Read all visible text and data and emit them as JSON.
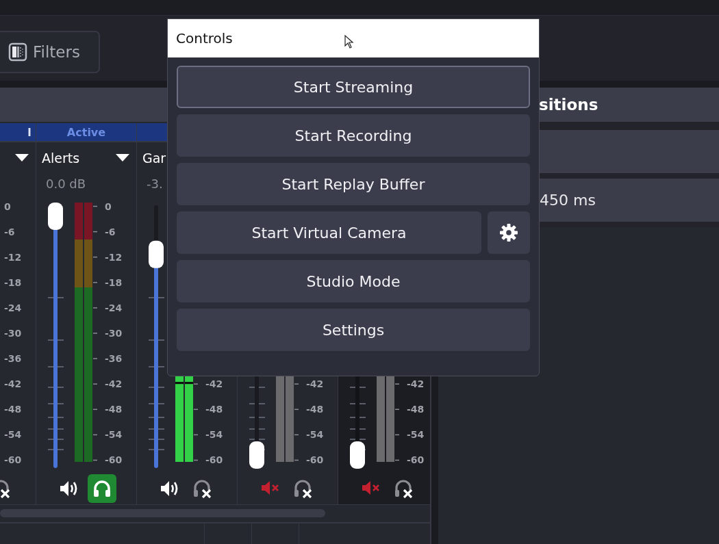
{
  "mixer_toolbar": {
    "filters_button": "Filters"
  },
  "mixer": {
    "channels": [
      {
        "tag": "l",
        "selected": false,
        "monitoring": false,
        "scale": [
          "0",
          "-6",
          "-12",
          "-18",
          "-24",
          "-30",
          "-36",
          "-42",
          "-48",
          "-54",
          "-60"
        ]
      },
      {
        "tag": "Active",
        "name": "Alerts",
        "readout": "0.0 dB",
        "fader": {
          "level": 1.0
        },
        "muted": false,
        "monitoring": true,
        "selected": false,
        "scale": [
          "0",
          "-6",
          "-12",
          "-18",
          "-24",
          "-30",
          "-36",
          "-42",
          "-48",
          "-54",
          "-60"
        ]
      },
      {
        "name": "Gar",
        "readout": "-3.",
        "fader": {
          "level": 0.84
        },
        "meter": {
          "level": 0.34
        },
        "muted": false,
        "monitoring": false,
        "selected": false,
        "scale": [
          "-42",
          "-48",
          "-54",
          "-60"
        ]
      },
      {
        "fader": {
          "level": 0
        },
        "muted": true,
        "monitoring": false,
        "selected": false,
        "scale": [
          "-42",
          "-48",
          "-54",
          "-60"
        ]
      },
      {
        "fader": {
          "level": 0
        },
        "muted": true,
        "monitoring": false,
        "selected": true,
        "scale": [
          "-42",
          "-48",
          "-54",
          "-60"
        ]
      }
    ]
  },
  "transitions": {
    "title": "sitions",
    "duration": "450 ms"
  },
  "controls": {
    "title": "Controls",
    "buttons": [
      {
        "label": "Start Streaming",
        "focused": true,
        "has_settings": false
      },
      {
        "label": "Start Recording",
        "focused": false,
        "has_settings": false
      },
      {
        "label": "Start Replay Buffer",
        "focused": false,
        "has_settings": false
      },
      {
        "label": "Start Virtual Camera",
        "focused": false,
        "has_settings": true
      },
      {
        "label": "Studio Mode",
        "focused": false,
        "has_settings": false
      },
      {
        "label": "Settings",
        "focused": false,
        "has_settings": false
      }
    ]
  }
}
